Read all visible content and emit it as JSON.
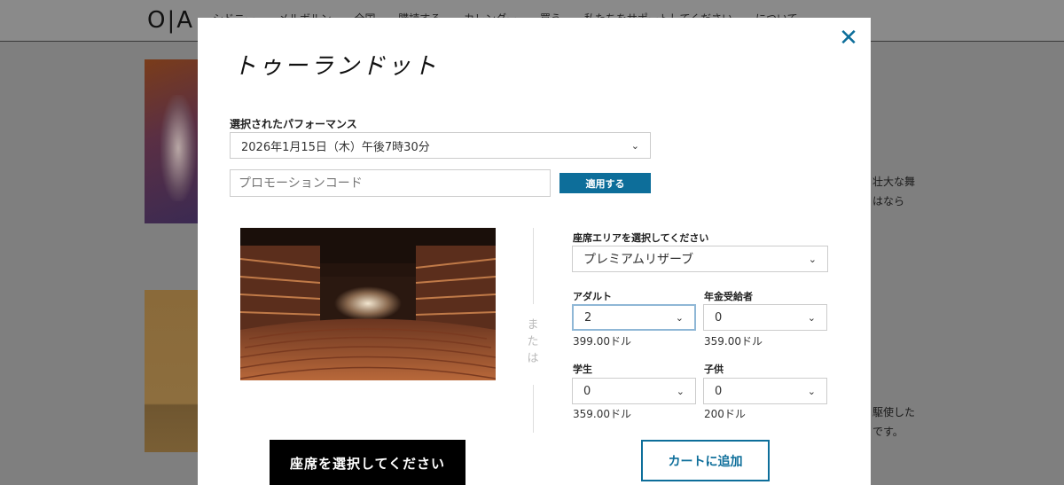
{
  "background": {
    "logo": "O|A",
    "nav": [
      "シドニー",
      "メルボルン",
      "全国",
      "購読する",
      "カレンダー",
      "買う",
      "私たちをサポートしてください",
      "について"
    ],
    "side_text_1": [
      "壮大な舞",
      "はなら"
    ],
    "side_text_2": [
      "駆使した",
      "です。"
    ]
  },
  "modal": {
    "title": "トゥーランドット",
    "close_icon": "close-icon",
    "performance_label": "選択されたパフォーマンス",
    "performance_value": "2026年1月15日（木）午後7時30分",
    "promo_placeholder": "プロモーションコード",
    "apply_label": "適用する",
    "or_text": "または",
    "choose_seats_label": "座席を選択してください",
    "seat_area_label": "座席エリアを選択してください",
    "seat_area_value": "プレミアムリザーブ",
    "tickets": [
      {
        "label": "アダルト",
        "qty": "2",
        "price": "399.00ドル"
      },
      {
        "label": "年金受給者",
        "qty": "0",
        "price": "359.00ドル"
      },
      {
        "label": "学生",
        "qty": "0",
        "price": "359.00ドル"
      },
      {
        "label": "子供",
        "qty": "0",
        "price": "200ドル"
      }
    ],
    "add_to_cart_label": "カートに追加"
  },
  "colors": {
    "accent": "#0d6e9a",
    "overlay": "#7f7f7f"
  }
}
